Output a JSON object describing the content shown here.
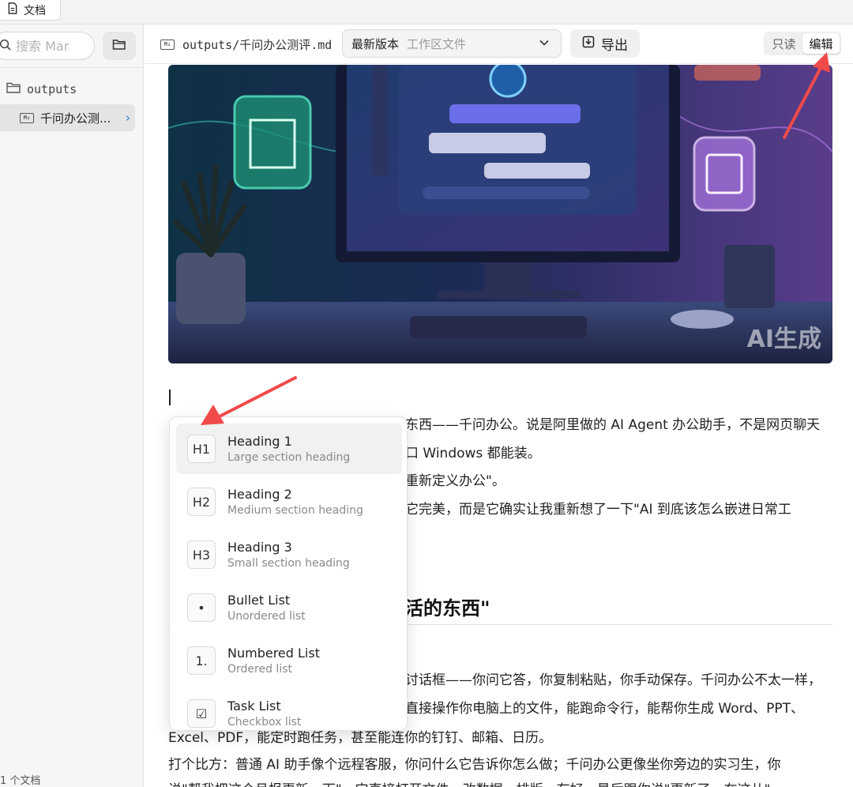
{
  "tab": {
    "label": "文档"
  },
  "sidebar": {
    "search_placeholder": "搜索 Mar",
    "folder_name": "outputs",
    "file_name": "千问办公测...",
    "doc_count": "1 个文档"
  },
  "header": {
    "file_path": "outputs/千问办公测评.md",
    "version_label": "最新版本",
    "version_sub": "工作区文件",
    "export_label": "导出",
    "mode_read": "只读",
    "mode_edit": "编辑"
  },
  "hero": {
    "watermark": "AI生成"
  },
  "paragraphs": {
    "p1": "东西——千问办公。说是阿里做的 AI Agent 办公助手，不是网页聊天",
    "p2": "口 Windows 都能装。",
    "p3": "重新定义办公\"。",
    "p4": "它完美，而是它确实让我重新想了一下\"AI 到底该怎么嵌进日常工",
    "p5": "讨话框——你问它答，你复制粘贴，你手动保存。千问办公不太一样，",
    "p6": "直接操作你电脑上的文件，能跑命令行，能帮你生成 Word、PPT、",
    "p7": "Excel、PDF，能定时跑任务，甚至能连你的钉钉、邮箱、日历。",
    "p8": "打个比方：普通 AI 助手像个远程客服，你问什么它告诉你怎么做；千问办公更像坐你旁边的实习生，你",
    "p9": "说\"帮我把这个月报更新一下\"，它直接打开文件、改数据、排版、存好，最后跟你说\"更新了，在这儿\""
  },
  "section_heading": "干活的东西\"",
  "slash_menu": {
    "items": [
      {
        "icon": "H1",
        "title": "Heading 1",
        "desc": "Large section heading"
      },
      {
        "icon": "H2",
        "title": "Heading 2",
        "desc": "Medium section heading"
      },
      {
        "icon": "H3",
        "title": "Heading 3",
        "desc": "Small section heading"
      },
      {
        "icon": "•",
        "title": "Bullet List",
        "desc": "Unordered list"
      },
      {
        "icon": "1.",
        "title": "Numbered List",
        "desc": "Ordered list"
      },
      {
        "icon": "☑",
        "title": "Task List",
        "desc": "Checkbox list"
      }
    ],
    "active_index": 0
  },
  "colors": {
    "accent": "#2f6fe0",
    "annotation_arrow": "#f04a4a"
  }
}
